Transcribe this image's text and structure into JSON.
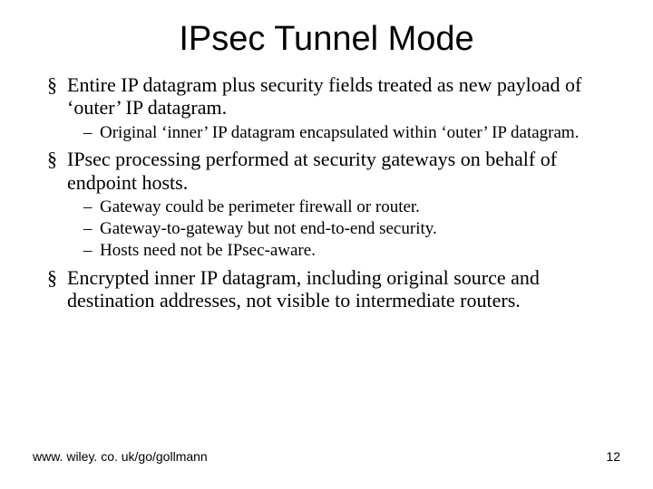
{
  "title": "IPsec Tunnel Mode",
  "bullets": [
    {
      "text": "Entire IP datagram plus security fields treated as new payload of ‘outer’ IP datagram.",
      "sub": [
        "Original ‘inner’ IP datagram encapsulated within ‘outer’ IP datagram."
      ]
    },
    {
      "text": "IPsec processing performed at security gateways on behalf of endpoint hosts.",
      "sub": [
        "Gateway could be perimeter firewall or router.",
        "Gateway-to-gateway but not end-to-end security.",
        "Hosts need not be IPsec-aware."
      ]
    },
    {
      "text": "Encrypted inner IP datagram, including original source and destination addresses, not visible to intermediate routers.",
      "sub": []
    }
  ],
  "footer": {
    "url": "www. wiley. co. uk/go/gollmann",
    "page": "12"
  }
}
